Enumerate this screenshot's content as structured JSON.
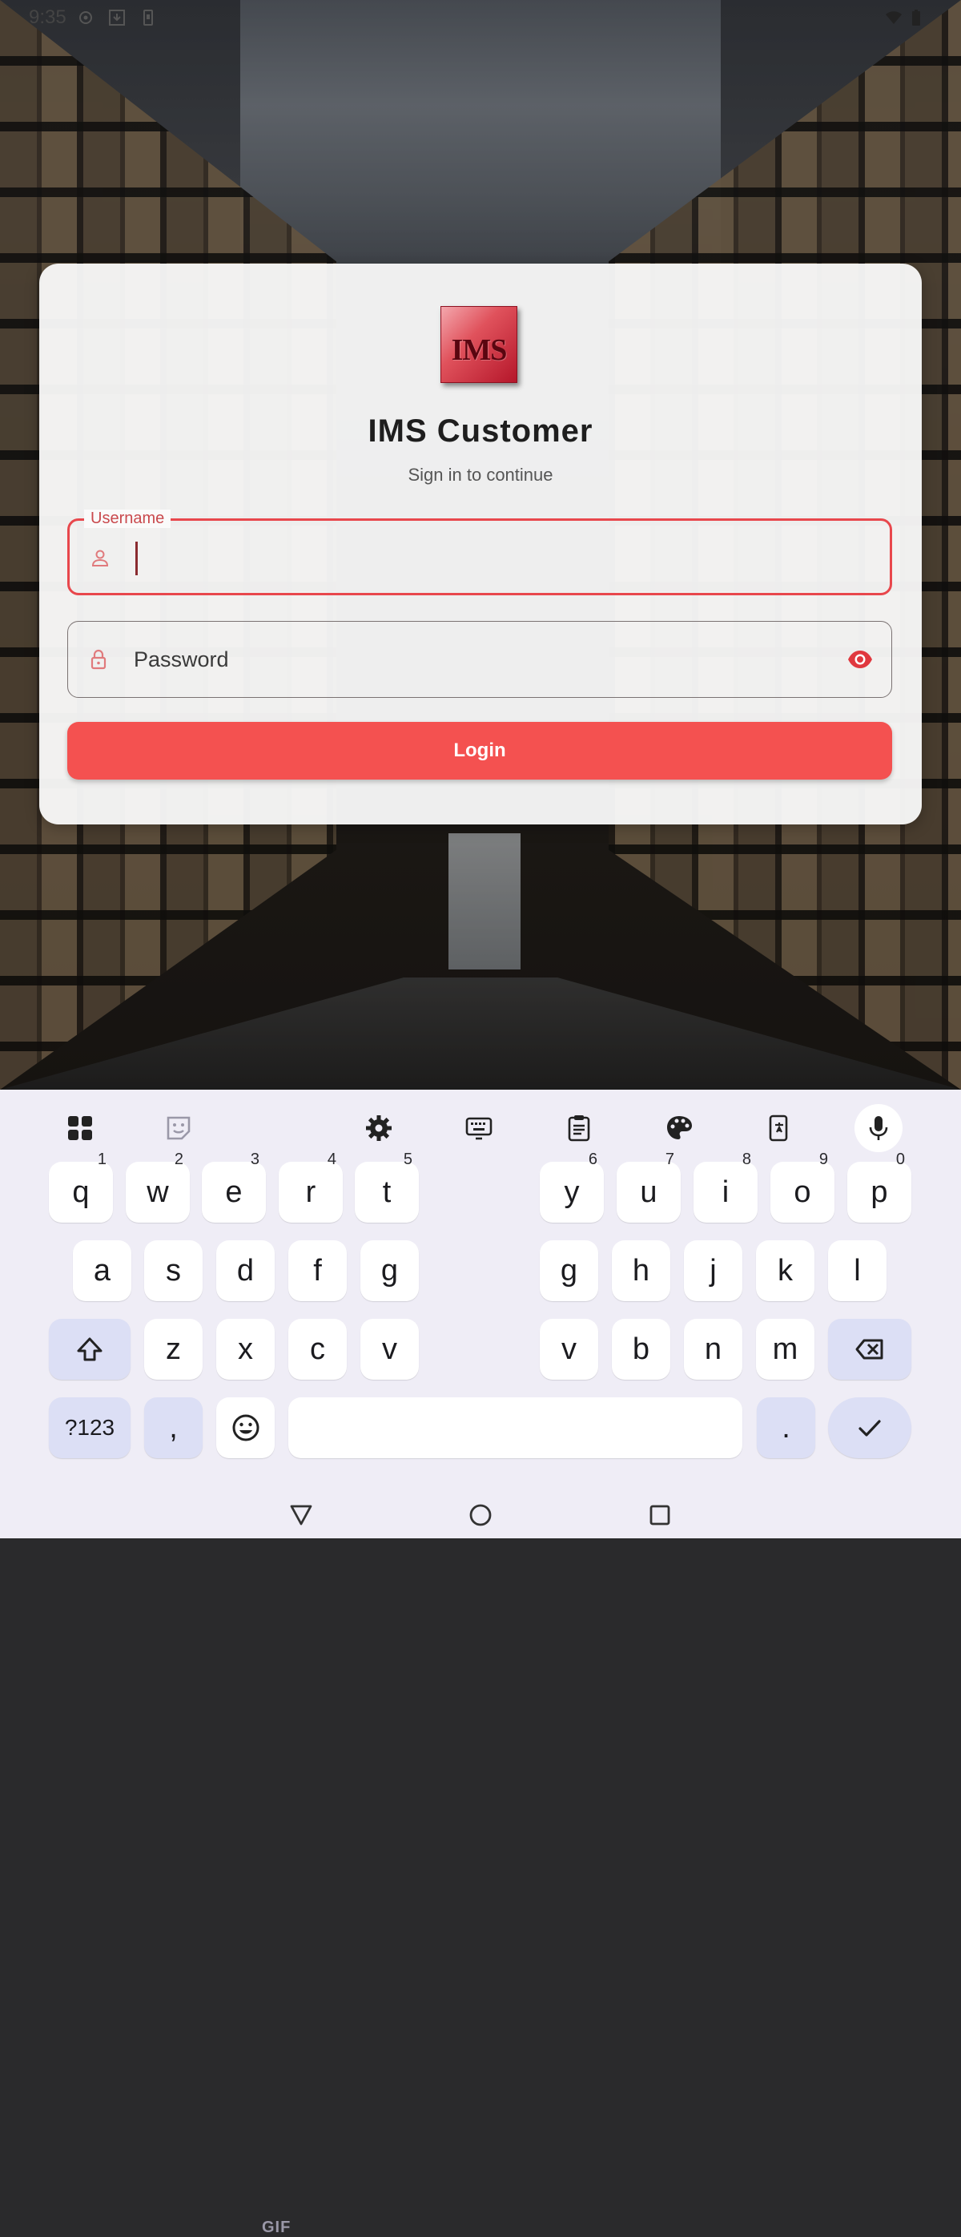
{
  "status_bar": {
    "time": "9:35"
  },
  "app": {
    "logo_text": "IMS",
    "title": "IMS Customer",
    "subtitle": "Sign in to continue"
  },
  "form": {
    "username_label": "Username",
    "username_value": "",
    "password_placeholder": "Password",
    "login_label": "Login"
  },
  "colors": {
    "accent": "#f45150",
    "focus_border": "#e8474c"
  },
  "keyboard": {
    "toolbar_icons": [
      "apps-grid-icon",
      "sticker-icon",
      "gif-icon",
      "settings-gear-icon",
      "keyboard-icon",
      "clipboard-icon",
      "palette-icon",
      "translate-icon",
      "microphone-icon"
    ],
    "gif_label": "GIF",
    "row1": [
      {
        "k": "q",
        "s": "1"
      },
      {
        "k": "w",
        "s": "2"
      },
      {
        "k": "e",
        "s": "3"
      },
      {
        "k": "r",
        "s": "4"
      },
      {
        "k": "t",
        "s": "5"
      },
      {
        "k": "y",
        "s": "6"
      },
      {
        "k": "u",
        "s": "7"
      },
      {
        "k": "i",
        "s": "8"
      },
      {
        "k": "o",
        "s": "9"
      },
      {
        "k": "p",
        "s": "0"
      }
    ],
    "row2": [
      "a",
      "s",
      "d",
      "f",
      "g",
      "g",
      "h",
      "j",
      "k",
      "l"
    ],
    "row3": [
      "z",
      "x",
      "c",
      "v",
      "v",
      "b",
      "n",
      "m"
    ],
    "symbols_label": "?123",
    "comma_label": ",",
    "period_label": "."
  }
}
